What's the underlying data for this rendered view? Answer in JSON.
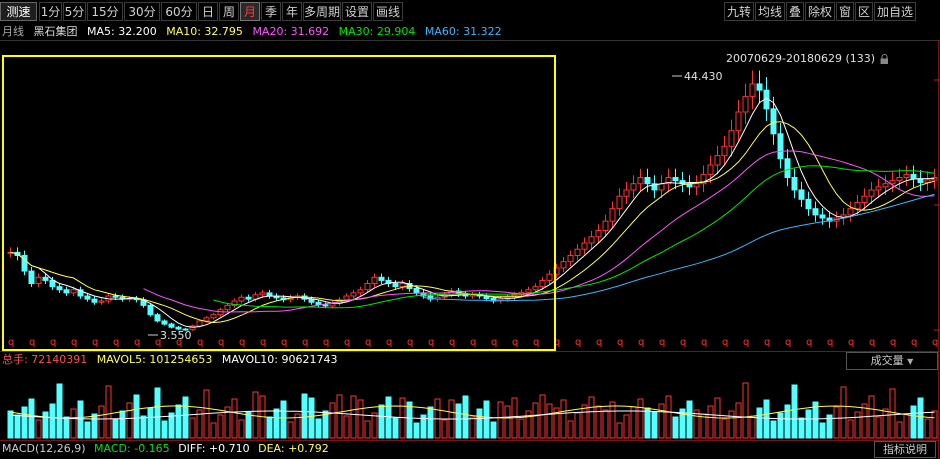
{
  "toolbar": {
    "logo": "测速",
    "periods": [
      "1分",
      "5分",
      "15分",
      "30分",
      "60分",
      "日",
      "周",
      "月",
      "季",
      "年",
      "多周期",
      "设置",
      "画线"
    ],
    "active_period": "月",
    "right_buttons": [
      "九转",
      "均线",
      "叠",
      "除权",
      "窗",
      "区",
      "加自选"
    ]
  },
  "info": {
    "period_label": "月线",
    "stock_name": "黑石集团",
    "ma5": "MA5: 32.200",
    "ma10": "MA10: 32.795",
    "ma20": "MA20: 31.692",
    "ma30": "MA30: 29.904",
    "ma60": "MA60: 31.322"
  },
  "range_label": "20070629-20180629 (133)",
  "annotations": {
    "high": "44.430",
    "low": "3.550",
    "marker": "q"
  },
  "volume": {
    "total": "总手: 72140391",
    "mavol5": "MAVOL5: 101254653",
    "mavol10": "MAVOL10: 90621743",
    "selector": "成交量"
  },
  "macd": {
    "params": "MACD(12,26,9)",
    "macd": "MACD: -0.165",
    "diff": "DIFF: +0.710",
    "dea": "DEA: +0.792",
    "help": "指标说明"
  },
  "colors": {
    "up": "#ff3232",
    "down": "#54ffff",
    "ma5": "#ffffff",
    "ma10": "#ffff54",
    "ma20": "#ff54ff",
    "ma30": "#00e600",
    "ma60": "#3cb4ff",
    "highlight": "#ffff00"
  }
}
